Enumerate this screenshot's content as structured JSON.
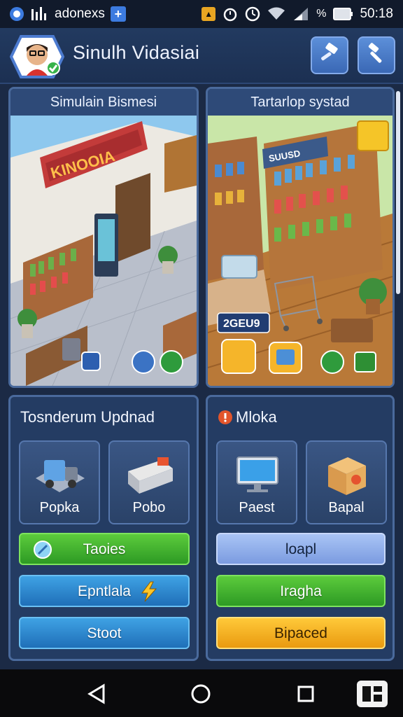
{
  "status_bar": {
    "app_name": "adonexs",
    "time": "50:18"
  },
  "header": {
    "title": "Sinulh Vidasiai"
  },
  "store_card_left": {
    "title": "Simulain Bismesi",
    "sign": "KINOOIA"
  },
  "store_card_right": {
    "title": "Tartarlop systad",
    "sign": "SUUSD",
    "price_tag": "2GEU9"
  },
  "upgrade_panel": {
    "title": "Tosnderum Updnad",
    "tiles": [
      {
        "label": "Popka",
        "icon": "delivery-truck-icon"
      },
      {
        "label": "Pobo",
        "icon": "counter-machine-icon"
      }
    ],
    "buttons": [
      {
        "label": "Taoies",
        "color": "green"
      },
      {
        "label": "Epntlala",
        "color": "blue"
      },
      {
        "label": "Stoot",
        "color": "blue"
      }
    ]
  },
  "shop_panel": {
    "title": "Mloka",
    "tiles": [
      {
        "label": "Paest",
        "icon": "monitor-icon"
      },
      {
        "label": "Bapal",
        "icon": "box-icon"
      }
    ],
    "buttons": [
      {
        "label": "loapl",
        "color": "lavender"
      },
      {
        "label": "Iragha",
        "color": "green"
      },
      {
        "label": "Bipaced",
        "color": "orange"
      }
    ]
  },
  "colors": {
    "background": "#1b2a45",
    "card": "#243c63",
    "green": "#3fb02e",
    "blue": "#2a86cf",
    "orange": "#f4b020",
    "lavender": "#92aeea"
  }
}
